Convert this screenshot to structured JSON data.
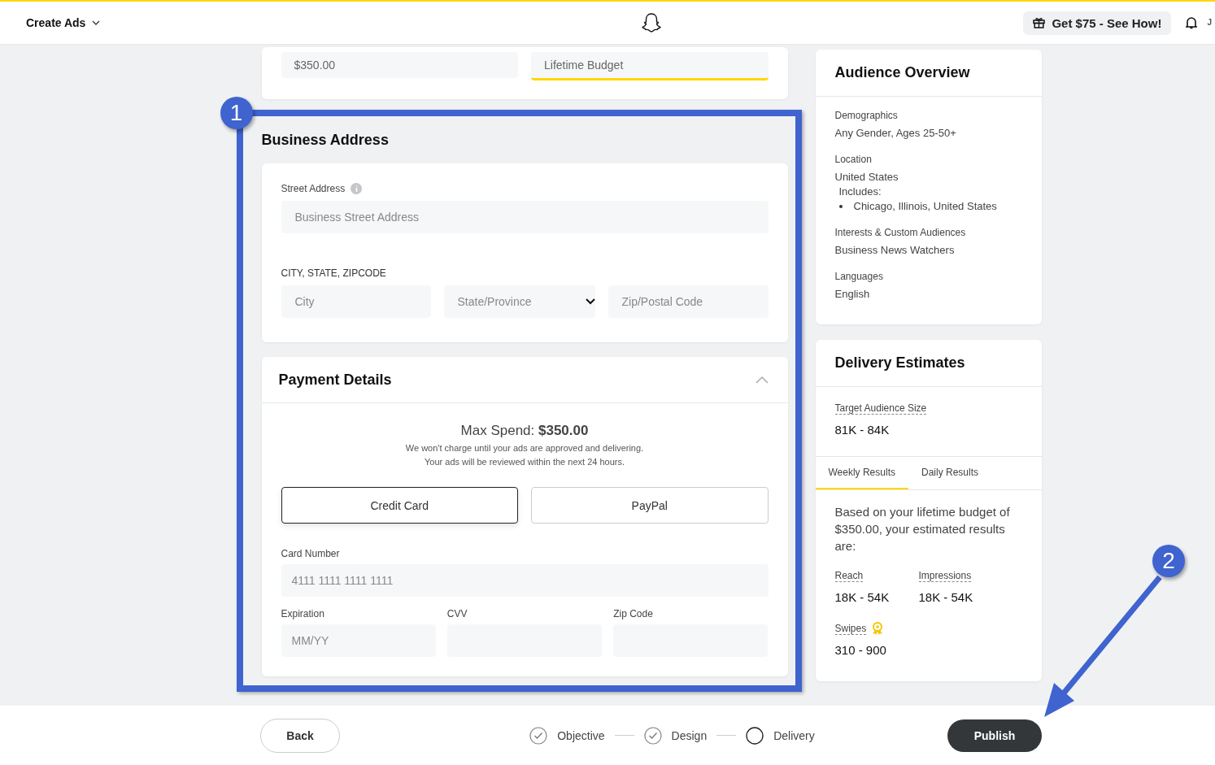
{
  "header": {
    "menu": "Create Ads",
    "promo": "Get $75 - See How!",
    "user": "J"
  },
  "budget_fields": [
    {
      "kind": "input",
      "value": "$350.00"
    },
    {
      "kind": "select",
      "value": "Lifetime Budget"
    }
  ],
  "business_address": {
    "title": "Business Address",
    "street_label": "Street Address",
    "street_placeholder": "Business Street Address",
    "city_label": "CITY, STATE, ZIPCODE",
    "fields": [
      {
        "kind": "input",
        "placeholder": "City"
      },
      {
        "kind": "select",
        "placeholder": "State/Province"
      },
      {
        "kind": "input",
        "placeholder": "Zip/Postal Code"
      }
    ]
  },
  "payment": {
    "title": "Payment Details",
    "expanded": true,
    "max_spend": "Max Spend: **$350.00**",
    "notes": [
      "We won't charge until your ads are approved and delivering.",
      "Your ads will be reviewed within the next 24 hours."
    ],
    "methods": [
      {
        "label": "Credit Card",
        "selected": true
      },
      {
        "label": "PayPal",
        "selected": false
      }
    ],
    "card_label": "Card Number",
    "card_placeholder": "4111 1111 1111 1111",
    "fields": [
      {
        "label": "Expiration",
        "placeholder": "MM/YY"
      },
      {
        "label": "CVV"
      },
      {
        "label": "Zip Code"
      }
    ]
  },
  "audience_overview": {
    "title": "Audience Overview",
    "sections": [
      {
        "label": "Demographics",
        "lines": [
          "Any Gender, Ages 25-50+"
        ]
      },
      {
        "label": "Location",
        "lines": [
          "United States"
        ],
        "sublabel": "Includes:",
        "bullets": [
          "Chicago, Illinois, United States"
        ]
      },
      {
        "label": "Interests & Custom Audiences",
        "lines": [
          "Business News Watchers"
        ]
      },
      {
        "label": "Languages",
        "lines": [
          "English"
        ]
      }
    ]
  },
  "delivery": {
    "title": "Delivery Estimates",
    "target_label": "Target Audience Size",
    "target_value": "81K - 84K",
    "tabs": [
      {
        "label": "Weekly Results",
        "selected": true
      },
      {
        "label": "Daily Results",
        "selected": false
      }
    ],
    "summary": "Based on your lifetime budget of $350.00, your estimated results are:",
    "metrics": [
      {
        "label": "Reach",
        "value": "18K - 54K",
        "award": false
      },
      {
        "label": "Impressions",
        "value": "18K - 54K",
        "award": false
      },
      {
        "label": "Swipes",
        "value": "310 - 900",
        "award": true
      }
    ]
  },
  "footer": {
    "back": "Back",
    "steps": [
      {
        "label": "Objective",
        "done": true
      },
      {
        "label": "Design",
        "done": true
      },
      {
        "label": "Delivery",
        "done": false
      }
    ],
    "publish": "Publish"
  },
  "annotations": [
    {
      "label": "1"
    },
    {
      "label": "2"
    }
  ]
}
